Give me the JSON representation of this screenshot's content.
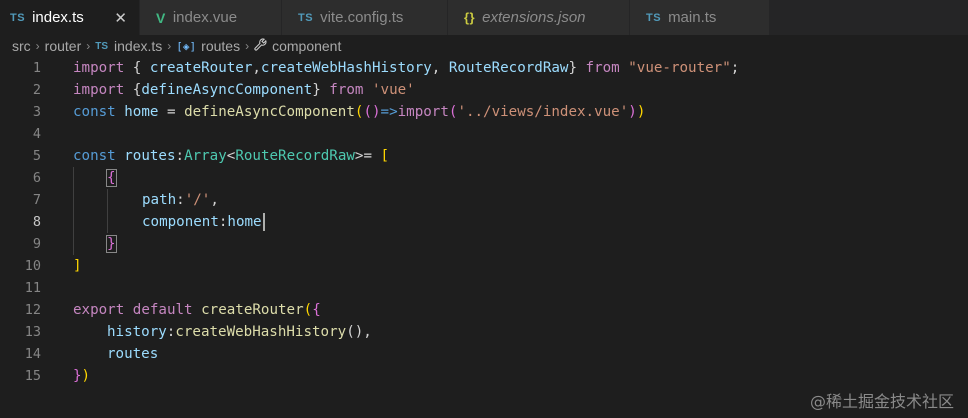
{
  "tabs": [
    {
      "icon": "TS",
      "label": "index.ts",
      "active": true,
      "close": "✕"
    },
    {
      "icon": "V",
      "label": "index.vue"
    },
    {
      "icon": "TS",
      "label": "vite.config.ts"
    },
    {
      "icon": "{}",
      "label": "extensions.json"
    },
    {
      "icon": "TS",
      "label": "main.ts"
    }
  ],
  "breadcrumb": {
    "src": "src",
    "router": "router",
    "file_icon": "TS",
    "file": "index.ts",
    "symbol_icon": "[◈]",
    "symbol": "routes",
    "prop_icon": "wrench",
    "prop": "component",
    "sep": "›"
  },
  "line_numbers": [
    "1",
    "2",
    "3",
    "4",
    "5",
    "6",
    "7",
    "8",
    "9",
    "10",
    "11",
    "12",
    "13",
    "14",
    "15"
  ],
  "code": {
    "l1": {
      "a": "import",
      "b": " { ",
      "c": "createRouter",
      "d": ",",
      "e": "createWebHashHistory",
      "f": ", ",
      "g": "RouteRecordRaw",
      "h": "} ",
      "i": "from",
      "j": " ",
      "k": "\"vue-router\"",
      "l": ";"
    },
    "l2": {
      "a": "import",
      "b": " {",
      "c": "defineAsyncComponent",
      "d": "} ",
      "e": "from",
      "f": " ",
      "g": "'vue'"
    },
    "l3": {
      "a": "const",
      "b": " ",
      "c": "home",
      "d": " = ",
      "e": "defineAsyncComponent",
      "f": "(",
      "g": "()",
      "h": "=>",
      "i": "import",
      "j": "(",
      "k": "'../views/index.vue'",
      "l": ")",
      "m": ")"
    },
    "l5": {
      "a": "const",
      "b": " ",
      "c": "routes",
      "d": ":",
      "e": "Array",
      "f": "<",
      "g": "RouteRecordRaw",
      "h": ">= ",
      "i": "["
    },
    "l6": {
      "a": "{"
    },
    "l7": {
      "a": "path",
      "b": ":",
      "c": "'/'",
      "d": ","
    },
    "l8": {
      "a": "component",
      "b": ":",
      "c": "home"
    },
    "l9": {
      "a": "}"
    },
    "l10": {
      "a": "]"
    },
    "l12": {
      "a": "export",
      "b": " ",
      "c": "default",
      "d": " ",
      "e": "createRouter",
      "f": "(",
      "g": "{"
    },
    "l13": {
      "a": "history",
      "b": ":",
      "c": "createWebHashHistory",
      "d": "()",
      "e": ","
    },
    "l14": {
      "a": "routes"
    },
    "l15": {
      "a": "}",
      "b": ")"
    }
  },
  "watermark": "@稀土掘金技术社区",
  "colors": {
    "keyword": "#569cd6",
    "control_keyword": "#c586c0",
    "function": "#dcdcaa",
    "variable": "#9cdcfe",
    "string": "#ce9178",
    "type": "#4ec9b0",
    "bracket_gold": "#ffd700",
    "bracket_orchid": "#da70d6",
    "background": "#1e1e1e"
  }
}
